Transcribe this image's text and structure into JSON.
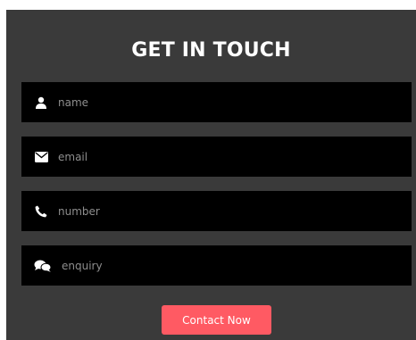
{
  "form": {
    "title": "GET IN TOUCH",
    "fields": [
      {
        "placeholder": "name",
        "icon": "user-icon",
        "value": ""
      },
      {
        "placeholder": "email",
        "icon": "envelope-icon",
        "value": ""
      },
      {
        "placeholder": "number",
        "icon": "phone-icon",
        "value": ""
      },
      {
        "placeholder": "enquiry",
        "icon": "chat-bubbles-icon",
        "value": ""
      }
    ],
    "submit_label": "Contact Now"
  },
  "colors": {
    "panel_bg": "#3a3a3a",
    "field_bg": "#000000",
    "button_bg": "#ff5a63",
    "text_white": "#ffffff"
  }
}
